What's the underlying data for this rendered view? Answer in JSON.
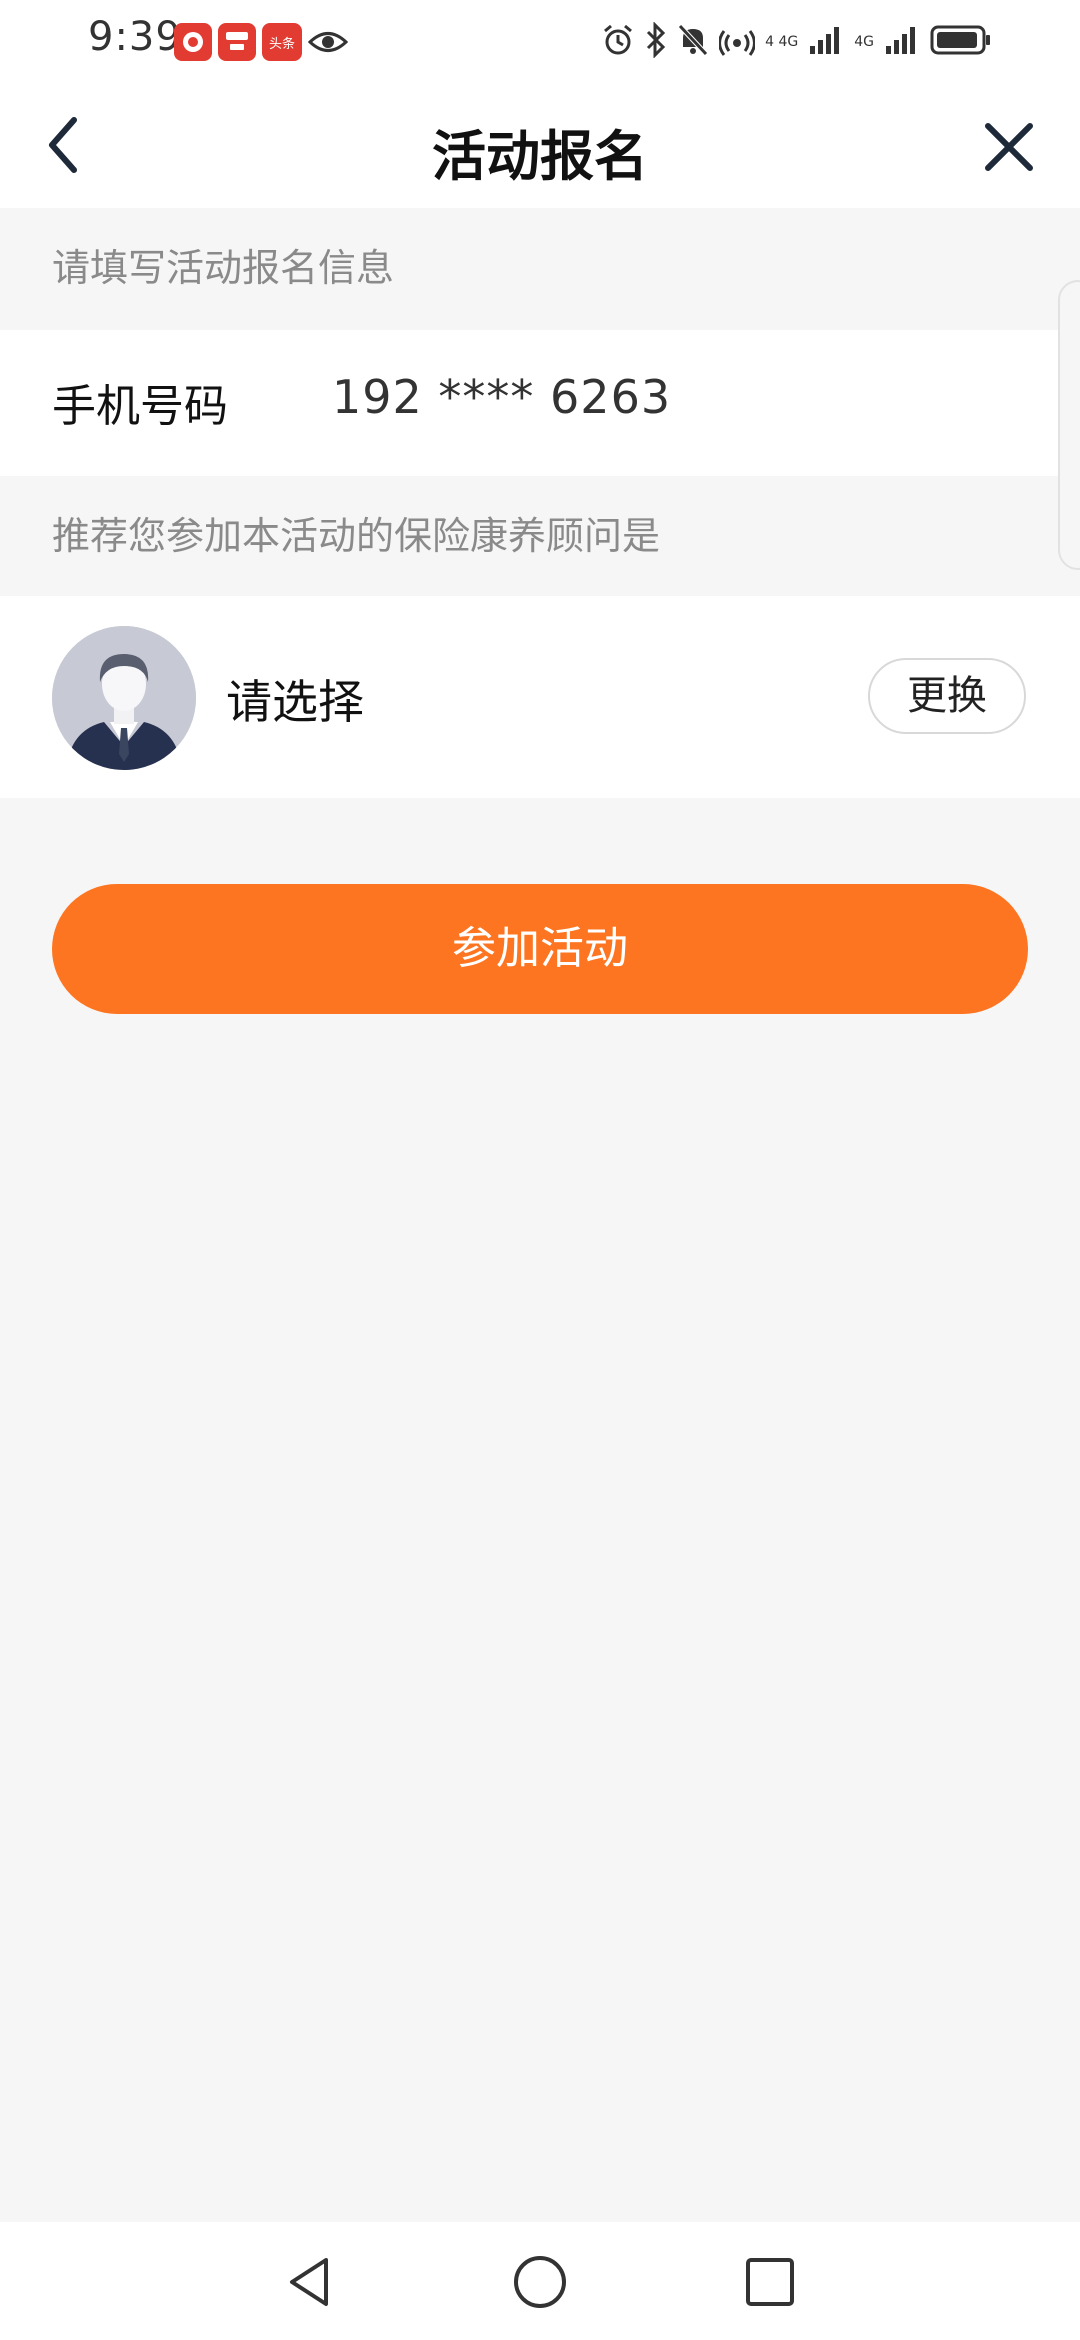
{
  "status_bar": {
    "time": "9:39",
    "app_icons": [
      {
        "name": "news-app-icon",
        "label": ""
      },
      {
        "name": "red-app-icon",
        "label": ""
      },
      {
        "name": "toutiao-app-icon",
        "label": "头条"
      }
    ],
    "eye_icon": "eye-icon",
    "right_icons": [
      "alarm-icon",
      "bluetooth-icon",
      "mute-icon",
      "hotspot-icon",
      "signal-icon",
      "signal-icon-2",
      "battery-icon"
    ],
    "net_labels": [
      "4 4G",
      "4G"
    ]
  },
  "header": {
    "title": "活动报名",
    "back_icon": "chevron-left-icon",
    "close_icon": "close-icon"
  },
  "form": {
    "info_hint": "请填写活动报名信息",
    "phone_label": "手机号码",
    "phone_value": "192 **** 6263",
    "advisor_hint": "推荐您参加本活动的保险康养顾问是",
    "advisor_placeholder": "请选择",
    "change_button": "更换"
  },
  "actions": {
    "join_button": "参加活动"
  },
  "colors": {
    "accent": "#fe7521",
    "background": "#f6f6f6",
    "card": "#ffffff",
    "hint_text": "#8a8a8a"
  },
  "system_nav": [
    "back-triangle-icon",
    "home-circle-icon",
    "recents-square-icon"
  ]
}
